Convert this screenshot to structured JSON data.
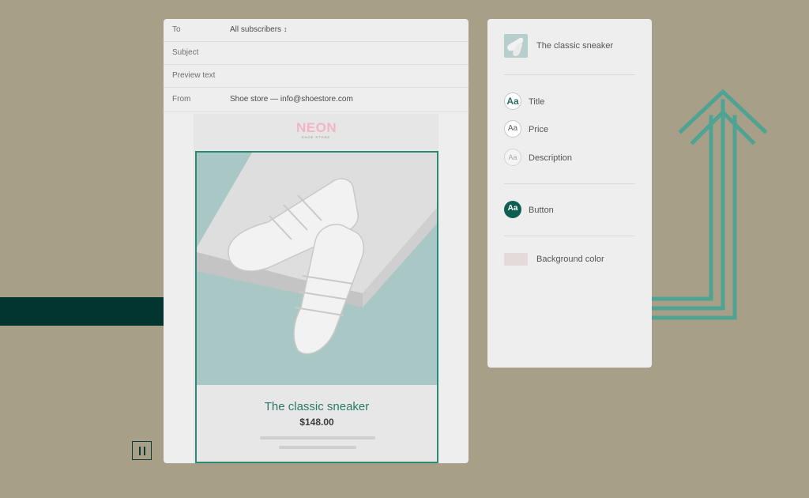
{
  "email": {
    "fields": [
      {
        "label": "To",
        "value": "All subscribers",
        "has_dropdown": true
      },
      {
        "label": "Subject",
        "value": ""
      },
      {
        "label": "Preview text",
        "value": ""
      },
      {
        "label": "From",
        "value": "Shoe store — info@shoestore.com"
      }
    ],
    "to_dropdown_icon": "chevron-updown-icon",
    "brand": {
      "name": "NEON",
      "sub": "SHOE STORE",
      "color": "#f2b5c6"
    },
    "product": {
      "title": "The classic sneaker",
      "price": "$148.00",
      "image_icon": "sneaker-photo"
    }
  },
  "panel": {
    "product_title": "The classic sneaker",
    "styles": [
      {
        "label": "Title",
        "icon_text": "Aa"
      },
      {
        "label": "Price",
        "icon_text": "Aa"
      },
      {
        "label": "Description",
        "icon_text": "Aa"
      }
    ],
    "button_style": {
      "label": "Button",
      "icon_text": "Aa"
    },
    "background": {
      "label": "Background color",
      "swatch_color": "#e5dada"
    }
  },
  "colors": {
    "accent": "#2c8b74",
    "arrow": "#4fa393",
    "dark_band": "#02352f",
    "backdrop": "#a89f88"
  },
  "controls": {
    "pause_icon": "pause-icon"
  }
}
